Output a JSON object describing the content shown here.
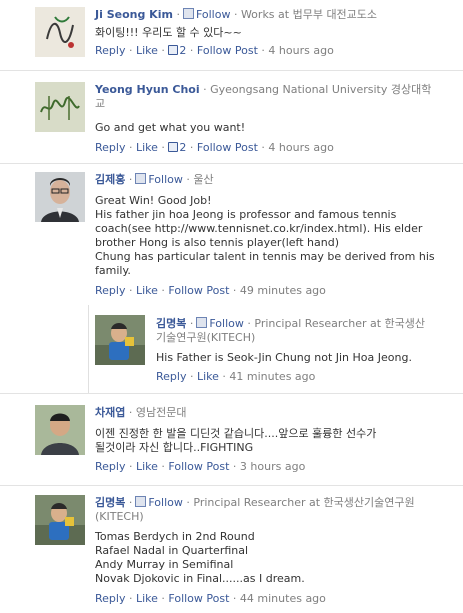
{
  "comments": [
    {
      "name": "Ji Seong Kim",
      "follow": "Follow",
      "meta": "Works at 법무부 대전교도소",
      "lines": [
        "화이팅!!! 우리도 할 수 있다~~"
      ],
      "reply": "Reply",
      "like": "Like",
      "likes_count": "2",
      "follow_post": "Follow Post",
      "time": "4 hours ago"
    },
    {
      "name": "Yeong Hyun Choi",
      "meta1": "Gyeongsang National University 경상대학",
      "meta2": "교",
      "lines": [
        "Go and get what you want!"
      ],
      "reply": "Reply",
      "like": "Like",
      "likes_count": "2",
      "follow_post": "Follow Post",
      "time": "4 hours ago"
    },
    {
      "name": "김제홍",
      "follow": "Follow",
      "meta": "울산",
      "lines": [
        "Great Win! Good Job!",
        "His father jin hoa Jeong is professor and famous tennis",
        "coach(see http://www.tennisnet.co.kr/index.html). His elder",
        "brother Hong is also tennis player(left hand)",
        "Chung has particular talent in tennis may be derived from his",
        "family."
      ],
      "reply": "Reply",
      "like": "Like",
      "follow_post": "Follow Post",
      "time": "49 minutes ago"
    },
    {
      "name": "김명복",
      "follow": "Follow",
      "meta1": "Principal Researcher at 한국생산",
      "meta2": "기술연구원(KITECH)",
      "lines": [
        "His Father is Seok-Jin Chung not Jin Hoa Jeong."
      ],
      "reply": "Reply",
      "like": "Like",
      "time": "41 minutes ago"
    },
    {
      "name": "차재엽",
      "meta": "영남전문대",
      "lines": [
        "이젠 진정한 한 발을 디딘것 같습니다....앞으로 훌륭한 선수가",
        "될것이라 자신 합니다..FIGHTING"
      ],
      "reply": "Reply",
      "like": "Like",
      "follow_post": "Follow Post",
      "time": "3 hours ago"
    },
    {
      "name": "김명복",
      "follow": "Follow",
      "meta1": "Principal Researcher at 한국생산기술연구원",
      "meta2": "(KITECH)",
      "lines": [
        "Tomas Berdych in 2nd Round",
        "Rafael Nadal in Quarterfinal",
        "Andy Murray in Semifinal",
        "Novak Djokovic in Final......as I dream."
      ],
      "reply": "Reply",
      "like": "Like",
      "follow_post": "Follow Post",
      "time": "44 minutes ago"
    }
  ],
  "sep": "·",
  "colors": {
    "link": "#3b5998",
    "meta": "#7f7f7f",
    "text": "#333333",
    "divider": "#e3e3e3"
  }
}
